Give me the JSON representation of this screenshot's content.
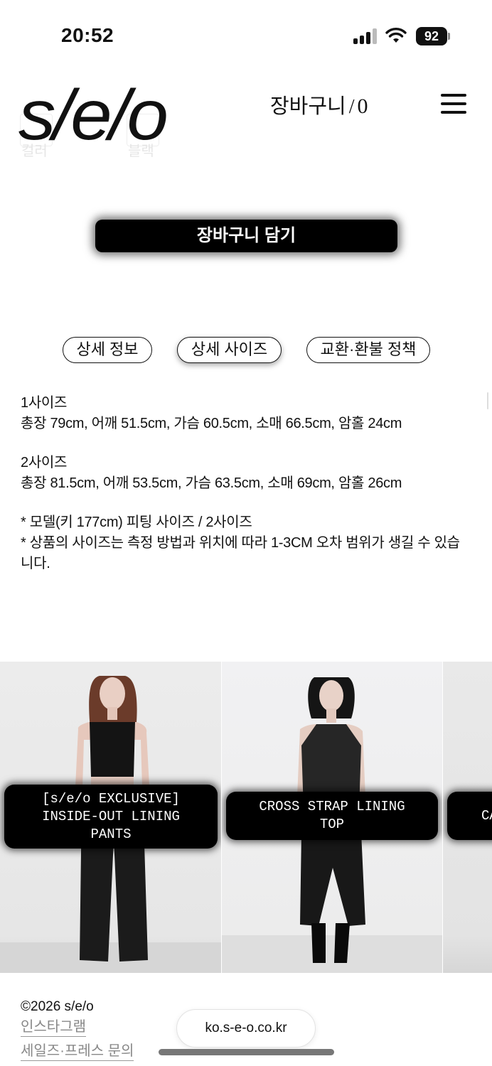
{
  "status_bar": {
    "time": "20:52",
    "battery": "92"
  },
  "header": {
    "logo": "s/e/o",
    "cart_label": "장바구니",
    "cart_separator": "/",
    "cart_count": "0",
    "ghost_labels": [
      "컬러",
      "블랙"
    ]
  },
  "add_to_cart": {
    "label": "장바구니 담기"
  },
  "tabs": [
    {
      "label": "상세 정보"
    },
    {
      "label": "상세 사이즈"
    },
    {
      "label": "교환·환불 정책"
    }
  ],
  "size_info": {
    "size1_title": "1사이즈",
    "size1_detail": "총장 79cm, 어깨 51.5cm, 가슴 60.5cm, 소매 66.5cm, 암홀 24cm",
    "size2_title": "2사이즈",
    "size2_detail": "총장 81.5cm, 어깨 53.5cm, 가슴 63.5cm, 소매 69cm, 암홀 26cm",
    "note1": "* 모델(키 177cm) 피팅 사이즈 / 2사이즈",
    "note2": "* 상품의 사이즈는 측정 방법과 위치에 따라 1-3CM 오차 범위가 생길 수 있습니다."
  },
  "related_products": [
    {
      "label": "[s/e/o EXCLUSIVE]\nINSIDE-OUT LINING\nPANTS"
    },
    {
      "label": "CROSS STRAP LINING\nTOP"
    },
    {
      "label": "CA"
    }
  ],
  "footer": {
    "copyright": "©2026 s/e/o",
    "instagram": "인스타그램",
    "sales_press": "세일즈·프레스 문의",
    "url": "ko.s-e-o.co.kr"
  }
}
